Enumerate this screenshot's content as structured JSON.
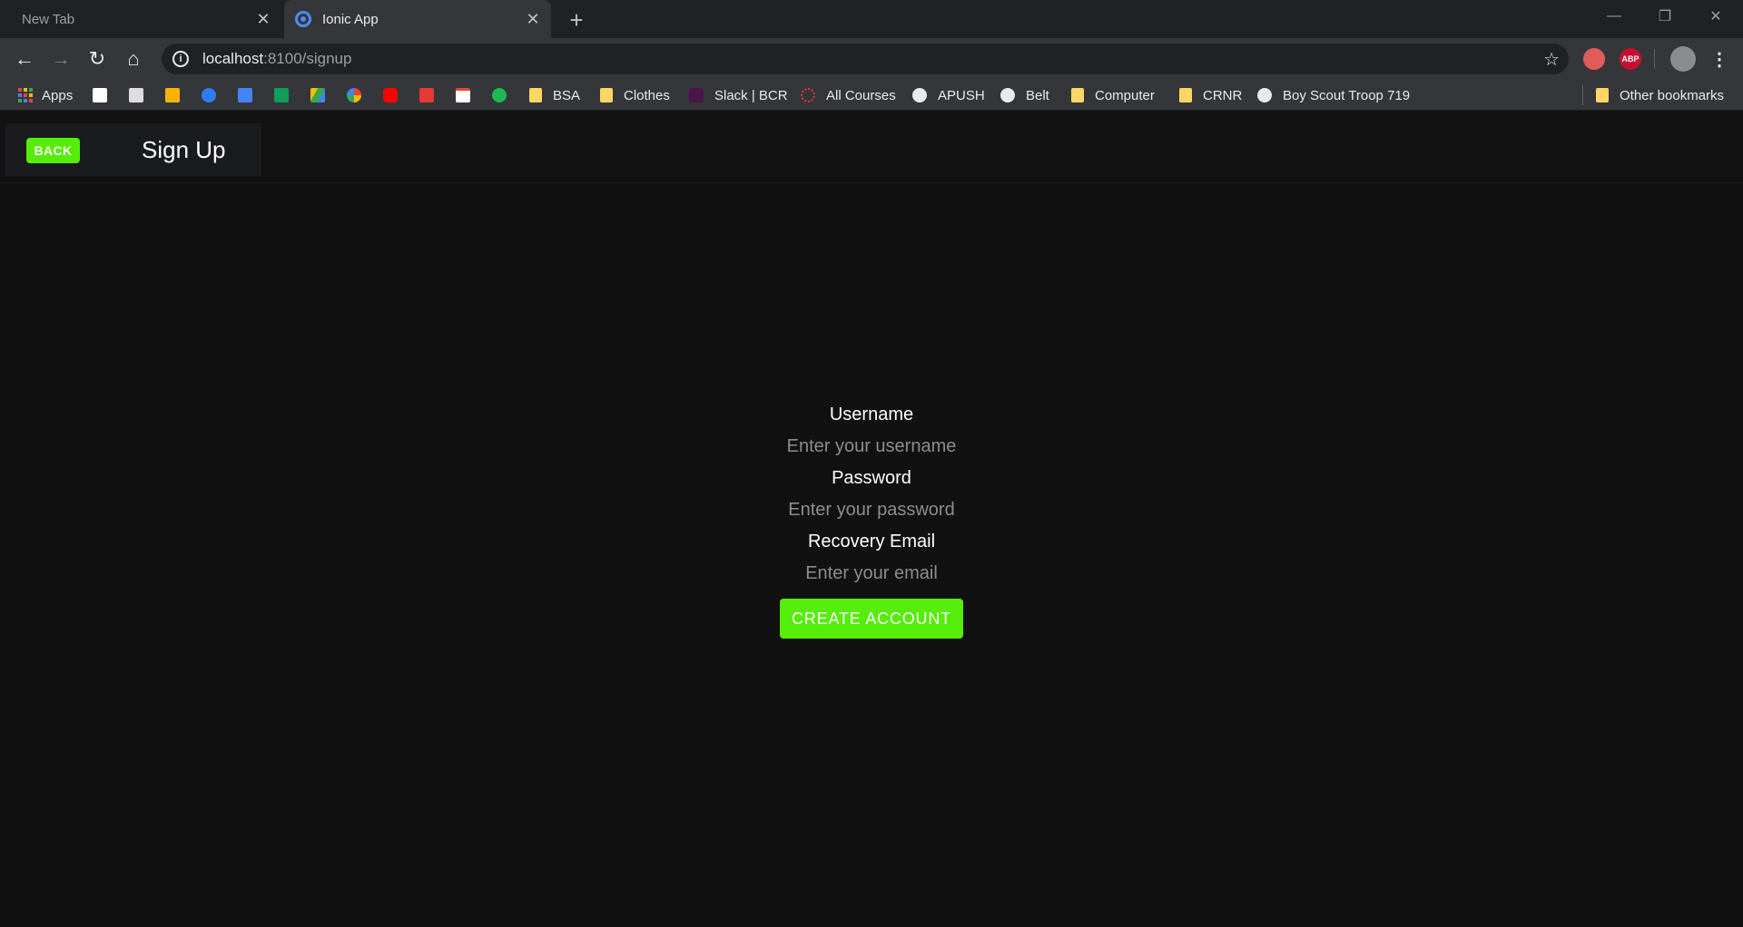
{
  "browser": {
    "tabs": [
      {
        "title": "New Tab"
      },
      {
        "title": "Ionic App"
      }
    ],
    "url_host": "localhost",
    "url_path": ":8100/signup",
    "extensions": {
      "abp": "ABP"
    },
    "bookmarks": [
      {
        "label": "Apps",
        "icon": "apps-grid-icon"
      },
      {
        "label": "",
        "icon": "d-icon"
      },
      {
        "label": "",
        "icon": "film-icon"
      },
      {
        "label": "",
        "icon": "slides-icon"
      },
      {
        "label": "",
        "icon": "meet-icon"
      },
      {
        "label": "",
        "icon": "docs-icon"
      },
      {
        "label": "",
        "icon": "sheets-icon"
      },
      {
        "label": "",
        "icon": "drive-icon"
      },
      {
        "label": "",
        "icon": "photos-icon"
      },
      {
        "label": "",
        "icon": "youtube-icon"
      },
      {
        "label": "",
        "icon": "red-square-icon"
      },
      {
        "label": "",
        "icon": "gmail-icon"
      },
      {
        "label": "",
        "icon": "spotify-icon"
      },
      {
        "label": "BSA",
        "icon": "folder-icon"
      },
      {
        "label": "Clothes",
        "icon": "folder-icon"
      },
      {
        "label": "Slack | BCR",
        "icon": "slack-icon"
      },
      {
        "label": "All Courses",
        "icon": "courses-icon"
      },
      {
        "label": "APUSH",
        "icon": "globe-icon"
      },
      {
        "label": "Belt",
        "icon": "globe-icon"
      },
      {
        "label": "Computer",
        "icon": "folder-icon"
      },
      {
        "label": "CRNR",
        "icon": "folder-icon"
      },
      {
        "label": "Boy Scout Troop 719",
        "icon": "globe-icon"
      }
    ],
    "other_bookmarks": "Other bookmarks"
  },
  "app": {
    "back_label": "BACK",
    "title": "Sign Up",
    "fields": [
      {
        "label": "Username",
        "placeholder": "Enter your username"
      },
      {
        "label": "Password",
        "placeholder": "Enter your password"
      },
      {
        "label": "Recovery Email",
        "placeholder": "Enter your email"
      }
    ],
    "submit_label": "CREATE ACCOUNT"
  },
  "colors": {
    "accent": "#55ed09",
    "background": "#111111",
    "header_box": "#1a1b1e"
  }
}
